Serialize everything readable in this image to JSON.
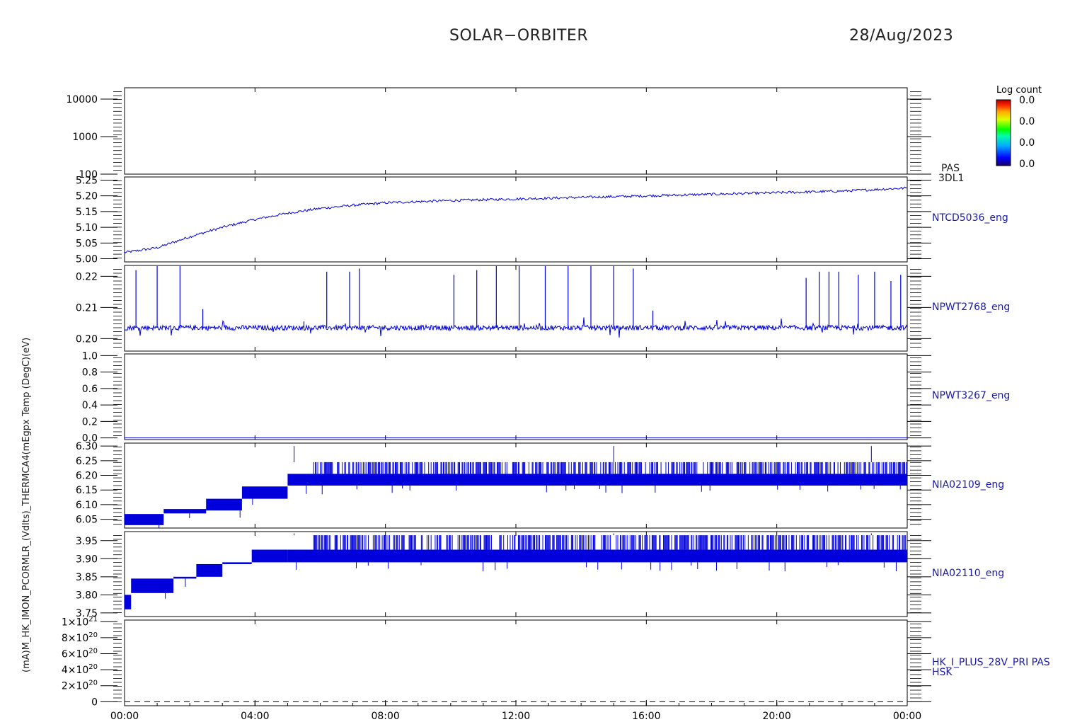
{
  "header": {
    "mission": "SOLAR−ORBITER",
    "date": "28/Aug/2023"
  },
  "colorbar": {
    "title": "Log count",
    "labels": [
      "0.0",
      "0.0",
      "0.0",
      "0.0"
    ]
  },
  "colors": {
    "trace": "#0000dd",
    "label": "#1a1aaa",
    "axis": "#000000"
  },
  "chart_data": {
    "type": "line",
    "x_axis": {
      "ticks": [
        "00:00",
        "04:00",
        "08:00",
        "12:00",
        "16:00",
        "20:00",
        "00:00"
      ],
      "range_hours": [
        0,
        24
      ]
    },
    "panels": [
      {
        "id": "pas",
        "kind": "spectrogram",
        "ylabel": "(eV)",
        "scale": "log",
        "ylim": [
          100,
          20000
        ],
        "yticks": [
          "10000",
          "1000",
          "100"
        ],
        "yticks_values": [
          10000,
          1000,
          100
        ],
        "right_label": [
          "PAS",
          "3DL1"
        ],
        "empty": true
      },
      {
        "id": "ntcd5036",
        "kind": "line",
        "ylabel": "Temp (DegC)",
        "ylim": [
          4.99,
          5.26
        ],
        "yticks": [
          "5.25",
          "5.20",
          "5.15",
          "5.10",
          "5.05",
          "5.00"
        ],
        "yticks_values": [
          5.25,
          5.2,
          5.15,
          5.1,
          5.05,
          5.0
        ],
        "right_label": [
          "NTCD5036_eng"
        ],
        "trend": [
          [
            0,
            5.02
          ],
          [
            1,
            5.035
          ],
          [
            2,
            5.07
          ],
          [
            3,
            5.1
          ],
          [
            4,
            5.125
          ],
          [
            5,
            5.145
          ],
          [
            6,
            5.16
          ],
          [
            7,
            5.17
          ],
          [
            8,
            5.178
          ],
          [
            10,
            5.185
          ],
          [
            12,
            5.19
          ],
          [
            14,
            5.195
          ],
          [
            16,
            5.2
          ],
          [
            18,
            5.205
          ],
          [
            20,
            5.21
          ],
          [
            22,
            5.215
          ],
          [
            24,
            5.225
          ]
        ],
        "noise": 0.004
      },
      {
        "id": "npwt2768",
        "kind": "spiky",
        "ylabel": "(A)",
        "ylim": [
          0.196,
          0.2235
        ],
        "yticks": [
          "0.22",
          "0.21",
          "0.20"
        ],
        "yticks_values": [
          0.22,
          0.21,
          0.2
        ],
        "right_label": [
          "NPWT2768_eng"
        ],
        "baseline": 0.2035,
        "noise": 0.0008,
        "spikes": [
          [
            0.35,
            0.222
          ],
          [
            1.0,
            0.2235
          ],
          [
            1.7,
            0.2235
          ],
          [
            2.4,
            0.2095
          ],
          [
            5.5,
            0.2055
          ],
          [
            6.2,
            0.2215
          ],
          [
            6.9,
            0.2215
          ],
          [
            7.2,
            0.2225
          ],
          [
            10.1,
            0.2205
          ],
          [
            10.8,
            0.222
          ],
          [
            11.4,
            0.2235
          ],
          [
            12.1,
            0.2255
          ],
          [
            12.9,
            0.2265
          ],
          [
            13.6,
            0.2265
          ],
          [
            14.3,
            0.2255
          ],
          [
            15.0,
            0.2265
          ],
          [
            15.6,
            0.2225
          ],
          [
            16.2,
            0.209
          ],
          [
            20.9,
            0.2195
          ],
          [
            21.3,
            0.2215
          ],
          [
            21.6,
            0.2215
          ],
          [
            21.9,
            0.2215
          ],
          [
            22.5,
            0.2205
          ],
          [
            23.0,
            0.2215
          ],
          [
            23.5,
            0.2185
          ],
          [
            23.8,
            0.2205
          ]
        ]
      },
      {
        "id": "npwt3267",
        "kind": "flat",
        "ylabel": "(ms)",
        "ylim": [
          -0.02,
          1.02
        ],
        "yticks": [
          "1.0",
          "0.8",
          "0.6",
          "0.4",
          "0.2",
          "0.0"
        ],
        "yticks_values": [
          1.0,
          0.8,
          0.6,
          0.4,
          0.2,
          0.0
        ],
        "right_label": [
          "NPWT3267_eng"
        ],
        "value": 0.0
      },
      {
        "id": "nia02109",
        "kind": "band",
        "ylabel": "(V)",
        "ylim": [
          6.02,
          6.31
        ],
        "yticks": [
          "6.30",
          "6.25",
          "6.20",
          "6.15",
          "6.10",
          "6.05"
        ],
        "yticks_values": [
          6.3,
          6.25,
          6.2,
          6.15,
          6.1,
          6.05
        ],
        "right_label": [
          "NIA02109_eng"
        ],
        "segments": [
          [
            0.0,
            1.2,
            6.03,
            6.068
          ],
          [
            1.2,
            2.5,
            6.07,
            6.085
          ],
          [
            2.5,
            3.6,
            6.08,
            6.12
          ],
          [
            3.6,
            5.0,
            6.12,
            6.162
          ],
          [
            5.0,
            24.0,
            6.165,
            6.205
          ]
        ],
        "upper_band": [
          6.205,
          6.245
        ],
        "spike_top": 6.3
      },
      {
        "id": "nia02110",
        "kind": "band",
        "ylabel": "(V)",
        "ylim": [
          3.74,
          3.975
        ],
        "yticks": [
          "3.95",
          "3.90",
          "3.85",
          "3.80",
          "3.75"
        ],
        "yticks_values": [
          3.95,
          3.9,
          3.85,
          3.8,
          3.75
        ],
        "right_label": [
          "NIA02110_eng"
        ],
        "segments": [
          [
            0.0,
            0.2,
            3.76,
            3.8
          ],
          [
            0.2,
            1.5,
            3.805,
            3.845
          ],
          [
            1.5,
            2.2,
            3.845,
            3.85
          ],
          [
            2.2,
            3.0,
            3.85,
            3.885
          ],
          [
            3.0,
            3.9,
            3.885,
            3.89
          ],
          [
            3.9,
            5.0,
            3.89,
            3.925
          ],
          [
            5.0,
            24.0,
            3.89,
            3.925
          ]
        ],
        "upper_band": [
          3.925,
          3.965
        ],
        "spike_top": 3.97
      },
      {
        "id": "hk_i_plus_28v",
        "kind": "dashed",
        "ylabel": "(mA)",
        "ylim": [
          -5e+19,
          1.02e+21
        ],
        "yticks": [
          "1×10",
          "8×10",
          "6×10",
          "4×10",
          "2×10",
          "0"
        ],
        "yticks_exp": [
          "21",
          "20",
          "20",
          "20",
          "20",
          ""
        ],
        "yticks_values": [
          1e+21,
          8e+20,
          6e+20,
          4e+20,
          2e+20,
          0
        ],
        "right_label": [
          "HK_I_PLUS_28V_PRI PAS",
          "HSK"
        ],
        "value": 0
      }
    ],
    "ylabel_overlay": "(mA)M_HK_IMON_PCORMLR_(Vdlts)_THERMCA4(mEgpx Temp (DegC)(eV)"
  }
}
